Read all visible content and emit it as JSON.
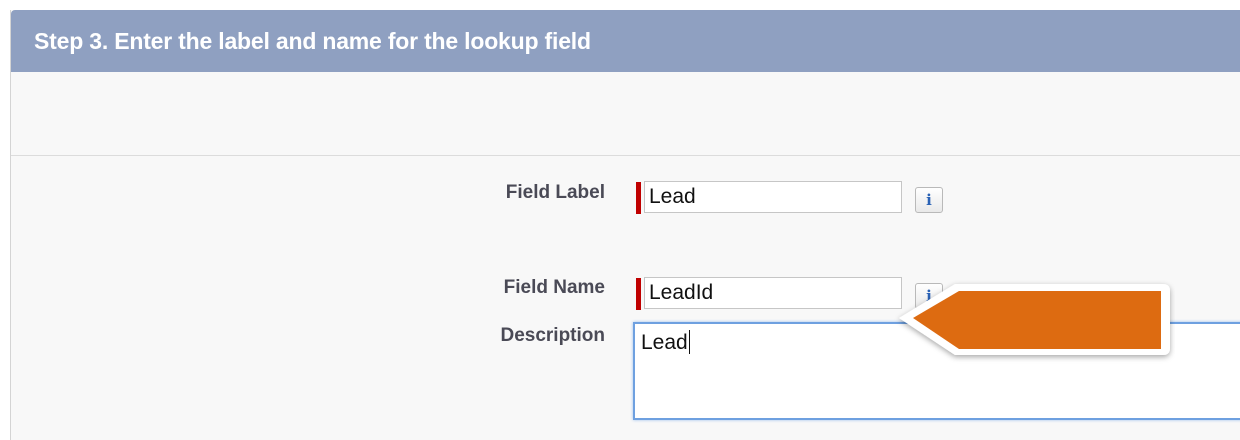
{
  "step": {
    "title": "Step 3. Enter the label and name for the lookup field"
  },
  "form": {
    "field_label": {
      "label": "Field Label",
      "value": "Lead",
      "required": true
    },
    "field_name": {
      "label": "Field Name",
      "value": "LeadId",
      "required": true
    },
    "description": {
      "label": "Description",
      "value": "Lead"
    },
    "info_icon": "i"
  },
  "colors": {
    "header_bg": "#8fa0c1",
    "required_marker": "#c00000",
    "callout_arrow": "#dd6b11",
    "focus_border": "#6ea0e0"
  },
  "icons": {
    "help": "info-icon",
    "callout": "arrow-callout-icon"
  }
}
